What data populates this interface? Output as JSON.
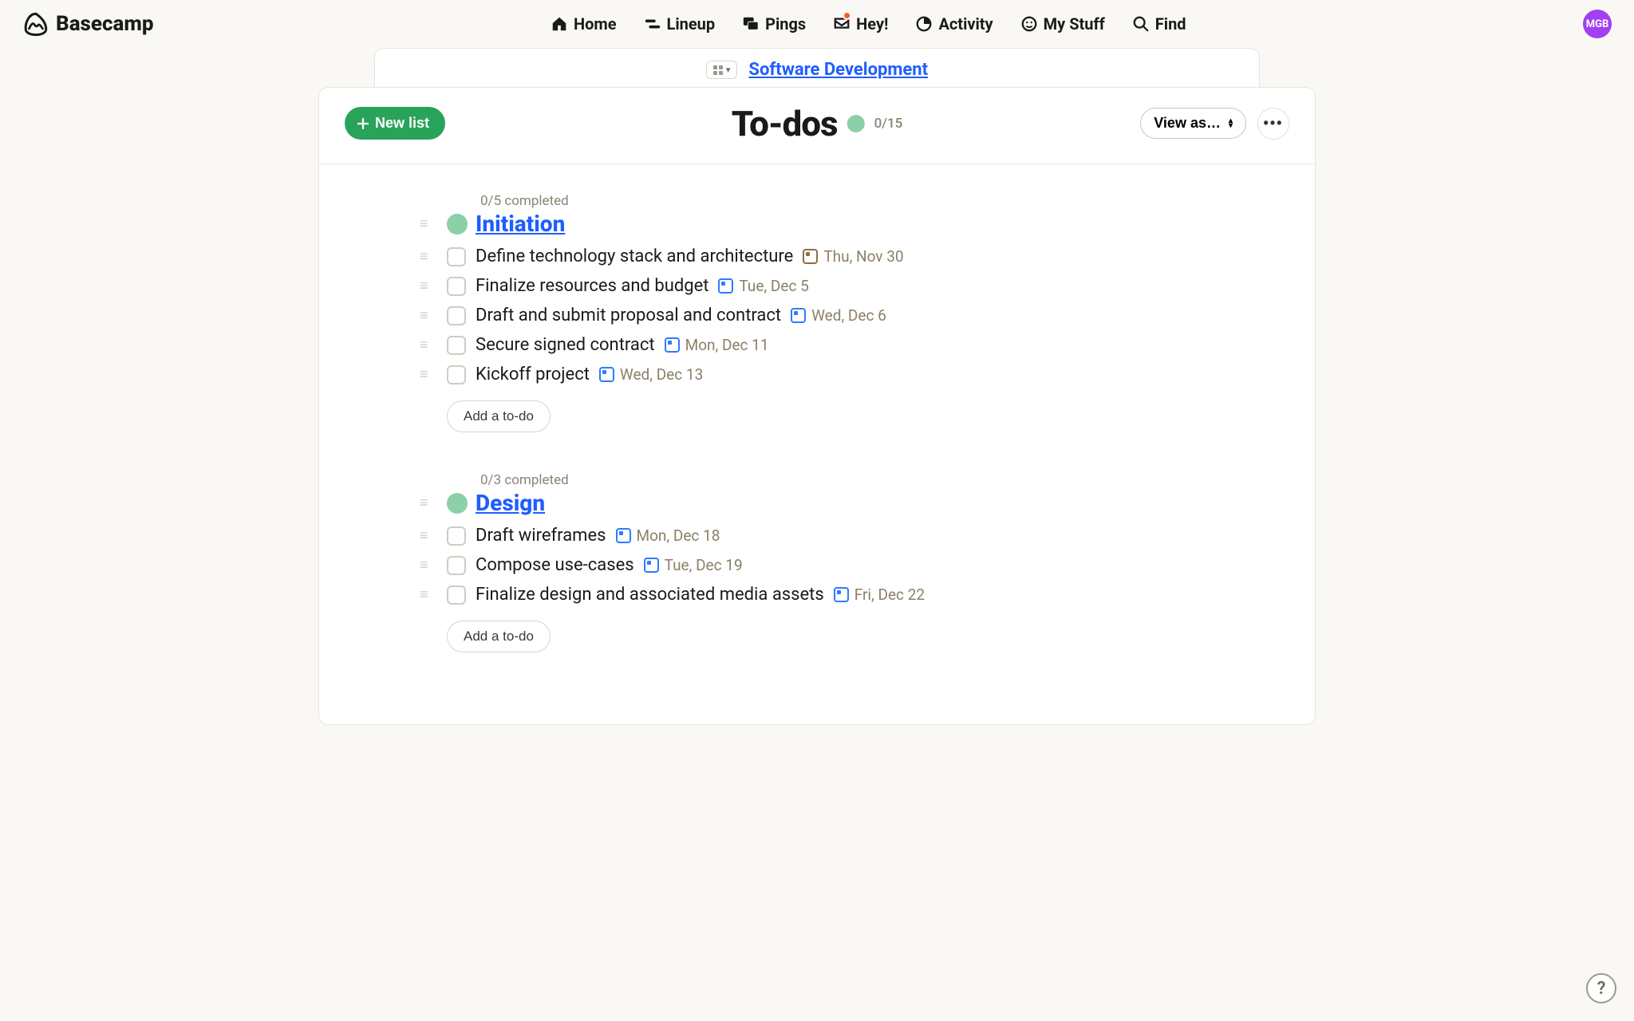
{
  "brand": "Basecamp",
  "nav": {
    "home": "Home",
    "lineup": "Lineup",
    "pings": "Pings",
    "hey": "Hey!",
    "activity": "Activity",
    "mystuff": "My Stuff",
    "find": "Find"
  },
  "avatar": "MGB",
  "breadcrumb": "Software Development",
  "header": {
    "new_list": "New list",
    "title": "To-dos",
    "count": "0/15",
    "view_as": "View as…"
  },
  "lists": [
    {
      "meta": "0/5 completed",
      "title": "Initiation",
      "items": [
        {
          "text": "Define technology stack and architecture",
          "date": "Thu, Nov 30",
          "cal": "brown"
        },
        {
          "text": "Finalize resources and budget",
          "date": "Tue, Dec 5",
          "cal": "blue"
        },
        {
          "text": "Draft and submit proposal and contract",
          "date": "Wed, Dec 6",
          "cal": "blue"
        },
        {
          "text": "Secure signed contract",
          "date": "Mon, Dec 11",
          "cal": "blue"
        },
        {
          "text": "Kickoff project",
          "date": "Wed, Dec 13",
          "cal": "blue"
        }
      ],
      "add": "Add a to-do"
    },
    {
      "meta": "0/3 completed",
      "title": "Design",
      "items": [
        {
          "text": "Draft wireframes",
          "date": "Mon, Dec 18",
          "cal": "blue"
        },
        {
          "text": "Compose use-cases",
          "date": "Tue, Dec 19",
          "cal": "blue"
        },
        {
          "text": "Finalize design and associated media assets",
          "date": "Fri, Dec 22",
          "cal": "blue"
        }
      ],
      "add": "Add a to-do"
    }
  ],
  "help": "?"
}
